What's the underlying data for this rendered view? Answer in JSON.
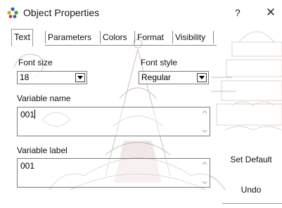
{
  "window": {
    "title": "Object Properties",
    "help": "?",
    "close": "✕"
  },
  "tabs": [
    "Text",
    "Parameters",
    "Colors",
    "Format",
    "Visibility"
  ],
  "form": {
    "font_size_label": "Font size",
    "font_size_value": "18",
    "font_style_label": "Font style",
    "font_style_value": "Regular",
    "variable_name_label": "Variable name",
    "variable_name_value": "001",
    "variable_label_label": "Variable label",
    "variable_label_value": "001"
  },
  "buttons": {
    "set_default": "Set Default",
    "undo": "Undo"
  }
}
